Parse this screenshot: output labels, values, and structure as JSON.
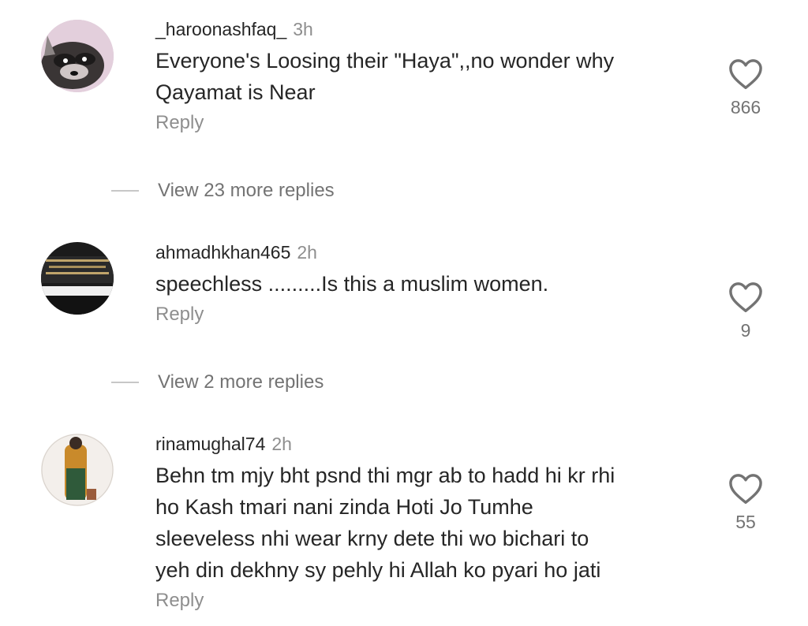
{
  "comments": [
    {
      "username": "_haroonashfaq_",
      "time": "3h",
      "text_lines": [
        "Everyone's Loosing their \"Haya\",,no wonder why",
        "Qayamat is Near"
      ],
      "reply_label": "Reply",
      "likes": "866",
      "view_replies": "View 23 more replies"
    },
    {
      "username": "ahmadhkhan465",
      "time": "2h",
      "text_lines": [
        "speechless .........Is this a muslim women."
      ],
      "reply_label": "Reply",
      "likes": "9",
      "view_replies": "View 2 more replies"
    },
    {
      "username": "rinamughal74",
      "time": "2h",
      "text_lines": [
        "Behn tm mjy bht psnd thi mgr ab to hadd hi kr rhi",
        "ho Kash tmari nani zinda Hoti Jo Tumhe",
        "sleeveless nhi wear krny dete thi wo bichari to",
        "yeh din dekhny sy pehly hi Allah ko pyari ho jati"
      ],
      "reply_label": "Reply",
      "likes": "55"
    }
  ],
  "icons": {
    "like": "heart-outline-icon"
  },
  "colors": {
    "primary_text": "#262626",
    "secondary_text": "#8e8e8e",
    "divider": "#c7c7c7"
  }
}
